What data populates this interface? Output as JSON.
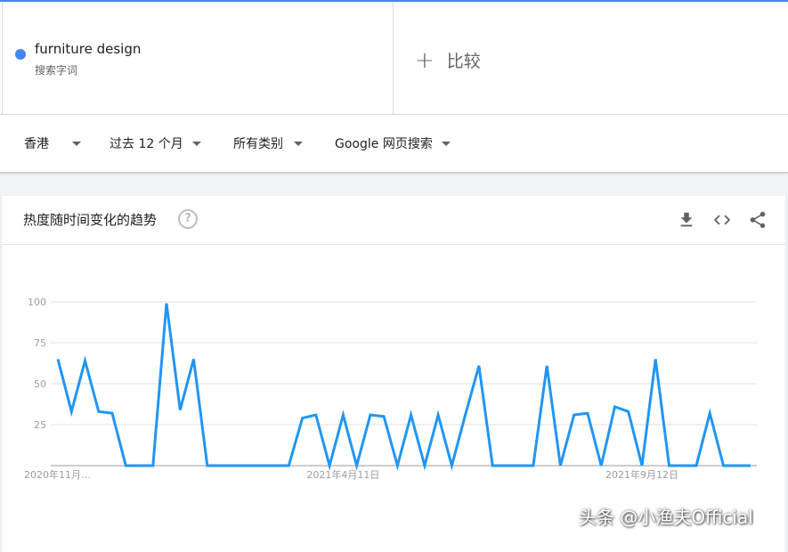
{
  "term": {
    "name": "furniture design",
    "sub": "搜索字词",
    "color": "#4285f4"
  },
  "compare": {
    "plus": "+",
    "label": "比较"
  },
  "filters": [
    {
      "label": "香港"
    },
    {
      "label": "过去 12 个月"
    },
    {
      "label": "所有类别"
    },
    {
      "label": "Google 网页搜索"
    }
  ],
  "card": {
    "title": "热度随时间变化的趋势",
    "help": "?",
    "icons": [
      "download-icon",
      "embed-icon",
      "share-icon"
    ]
  },
  "chart_data": {
    "type": "line",
    "color": "#2196f3",
    "ylim": [
      0,
      100
    ],
    "yticks": [
      25,
      50,
      75,
      100
    ],
    "grid": true,
    "xtick_labels": [
      {
        "label": "2020年11月…",
        "index": 0
      },
      {
        "label": "2021年4月11日",
        "index": 21
      },
      {
        "label": "2021年9月12日",
        "index": 43
      }
    ],
    "series": [
      {
        "values": [
          65,
          33,
          64,
          33,
          32,
          0,
          0,
          0,
          99,
          34,
          65,
          0,
          0,
          0,
          0,
          0,
          0,
          0,
          29,
          31,
          0,
          31,
          0,
          31,
          30,
          0,
          31,
          0,
          31,
          0,
          31,
          61,
          0,
          0,
          0,
          0,
          61,
          0,
          31,
          32,
          0,
          36,
          33,
          0,
          65,
          0,
          0,
          0,
          32,
          0,
          0,
          0
        ]
      }
    ]
  },
  "watermark": "头条 @小渔夫Official"
}
